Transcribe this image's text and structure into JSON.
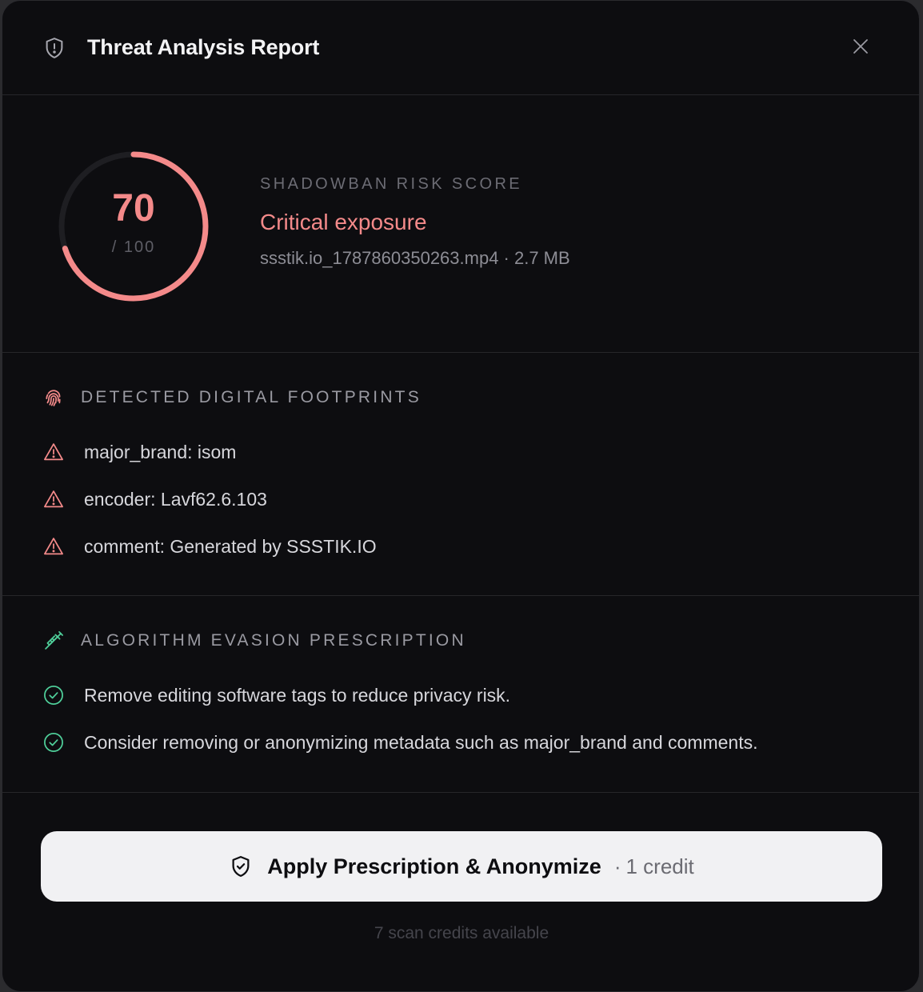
{
  "header": {
    "title": "Threat Analysis Report",
    "icon": "shield-alert-icon",
    "close_icon": "close-icon"
  },
  "score": {
    "value": "70",
    "max": "/ 100",
    "progress": 0.7,
    "label": "SHADOWBAN RISK SCORE",
    "status": "Critical exposure",
    "file": "ssstik.io_1787860350263.mp4 · 2.7 MB"
  },
  "footprints": {
    "title": "DETECTED DIGITAL FOOTPRINTS",
    "icon": "fingerprint-icon",
    "items": [
      {
        "text": "major_brand: isom",
        "icon": "warning-icon"
      },
      {
        "text": "encoder: Lavf62.6.103",
        "icon": "warning-icon"
      },
      {
        "text": "comment: Generated by SSSTIK.IO",
        "icon": "warning-icon"
      }
    ]
  },
  "prescription": {
    "title": "ALGORITHM EVASION PRESCRIPTION",
    "icon": "syringe-icon",
    "items": [
      {
        "text": "Remove editing software tags to reduce privacy risk.",
        "icon": "check-circle-icon"
      },
      {
        "text": "Consider removing or anonymizing metadata such as major_brand and comments.",
        "icon": "check-circle-icon"
      }
    ]
  },
  "cta": {
    "label": "Apply Prescription & Anonymize",
    "separator": "·",
    "credit": "1 credit",
    "icon": "shield-check-icon"
  },
  "credits_note": "7 scan credits available",
  "colors": {
    "accent_red": "#f48a8a",
    "accent_green": "#4fcf9a",
    "background": "#0d0d10"
  }
}
